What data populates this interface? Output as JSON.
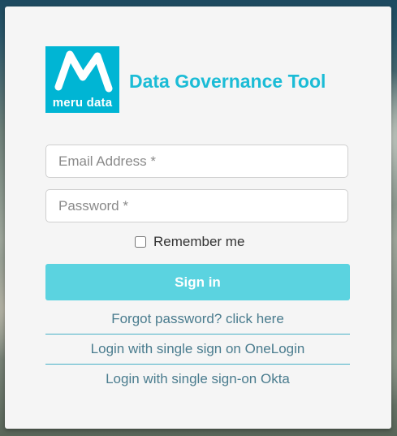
{
  "brand": {
    "logo_text": "meru data",
    "app_title": "Data Governance Tool",
    "accent_color": "#1bbcd6",
    "logo_color": "#00b5d4"
  },
  "form": {
    "email_placeholder": "Email Address *",
    "email_value": "",
    "password_placeholder": "Password *",
    "password_value": "",
    "remember_label": "Remember me",
    "remember_checked": false,
    "signin_label": "Sign in",
    "button_color": "#5bd3e0"
  },
  "links": {
    "forgot": "Forgot password? click here",
    "onelogin": "Login with single sign on OneLogin",
    "okta": "Login with single sign-on Okta"
  }
}
